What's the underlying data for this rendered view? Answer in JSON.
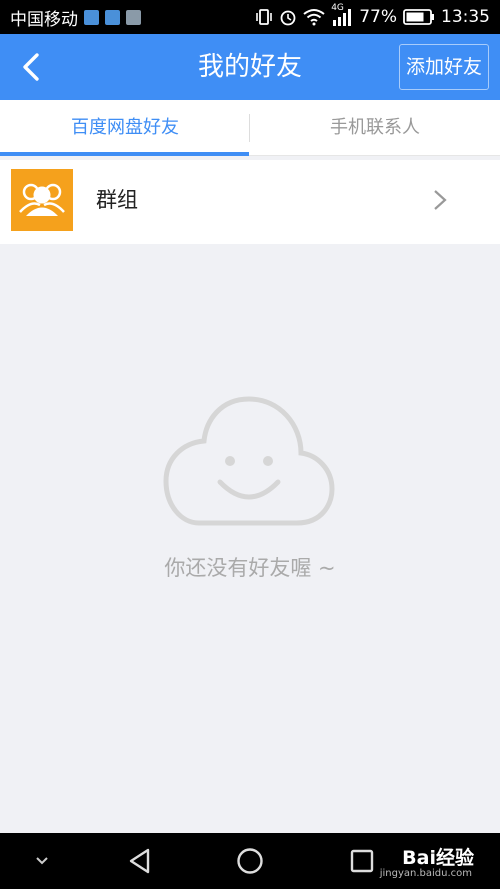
{
  "status_bar": {
    "carrier": "中国移动",
    "network": "4G",
    "battery": "77%",
    "time": "13:35",
    "icons": [
      "location-app-icon",
      "maps-app-icon",
      "gallery-app-icon",
      "vibrate-icon",
      "alarm-icon",
      "wifi-icon",
      "signal-icon",
      "battery-icon"
    ]
  },
  "header": {
    "title": "我的好友",
    "add_button": "添加好友",
    "back_icon": "back-arrow-icon",
    "background": "#3f8ef5"
  },
  "tabs": [
    {
      "label": "百度网盘好友",
      "active": true
    },
    {
      "label": "手机联系人",
      "active": false
    }
  ],
  "group_row": {
    "label": "群组",
    "avatar_color": "#f5a11c",
    "icon": "people-icon"
  },
  "empty_state": {
    "message": "你还没有好友喔 ~",
    "icon": "smiling-cloud-icon"
  },
  "nav_bar": {
    "items": [
      "collapse-icon",
      "back-triangle-icon",
      "home-circle-icon",
      "recents-square-icon"
    ],
    "watermark": "Bai经验",
    "watermark_sub": "jingyan.baidu.com"
  }
}
